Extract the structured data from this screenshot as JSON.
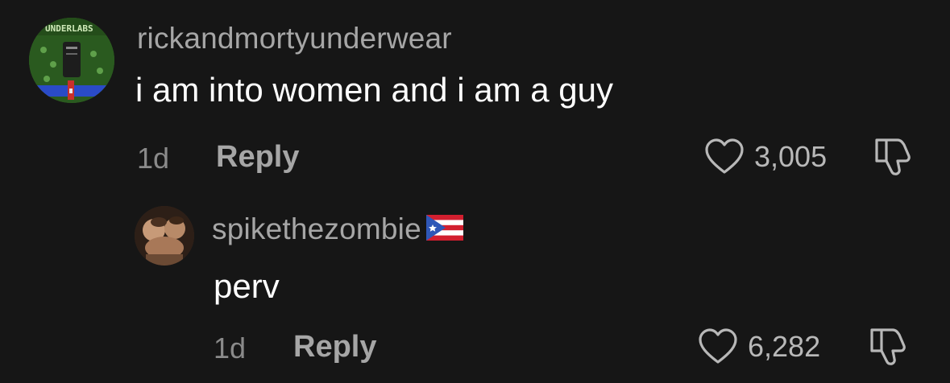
{
  "comments": [
    {
      "username": "rickandmortyunderwear",
      "text": "i am into women and i am a guy",
      "time": "1d",
      "reply_label": "Reply",
      "likes": "3,005",
      "avatar_text": "UNDERLABS"
    },
    {
      "username": "spikethezombie",
      "flag": "puerto-rico-flag-icon",
      "text": "perv",
      "time": "1d",
      "reply_label": "Reply",
      "likes": "6,282"
    }
  ],
  "icons": {
    "like": "heart-outline-icon",
    "dislike": "thumbs-down-outline-icon"
  },
  "colors": {
    "background": "#161616",
    "username": "#a6a6a6",
    "text": "#ffffff",
    "meta": "#8a8a8a"
  }
}
